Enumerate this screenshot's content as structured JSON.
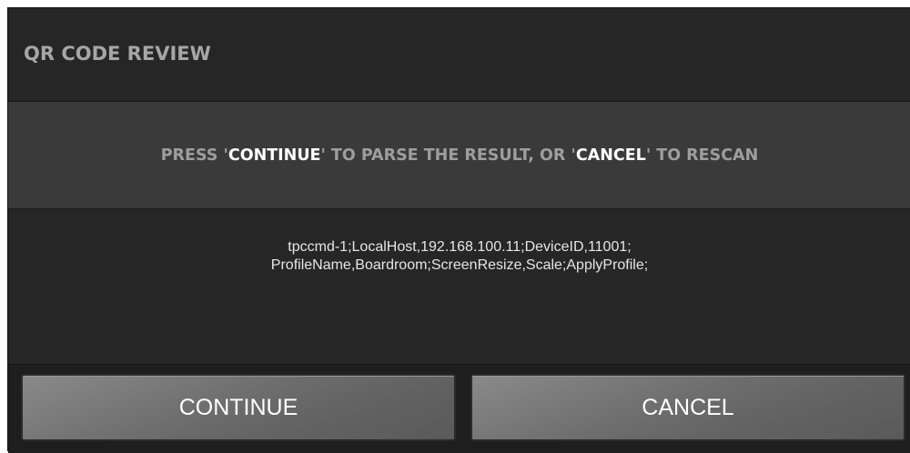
{
  "dialog": {
    "title": "QR CODE REVIEW",
    "instruction": {
      "part1": "PRESS '",
      "continue_word": "CONTINUE",
      "part2": "' TO PARSE THE RESULT, OR '",
      "cancel_word": "CANCEL",
      "part3": "' TO RESCAN"
    },
    "result_lines": [
      "tpccmd-1;LocalHost,192.168.100.11;DeviceID,11001;",
      "ProfileName,Boardroom;ScreenResize,Scale;ApplyProfile;"
    ],
    "buttons": {
      "continue_label": "CONTINUE",
      "cancel_label": "CANCEL"
    }
  },
  "colors": {
    "background": "#262626",
    "instruction_band": "#3a3a3a",
    "title_text": "#a6a6a6",
    "instruction_text": "#9e9e9e",
    "highlight_text": "#ffffff",
    "button_face": "#6e6e6e"
  }
}
